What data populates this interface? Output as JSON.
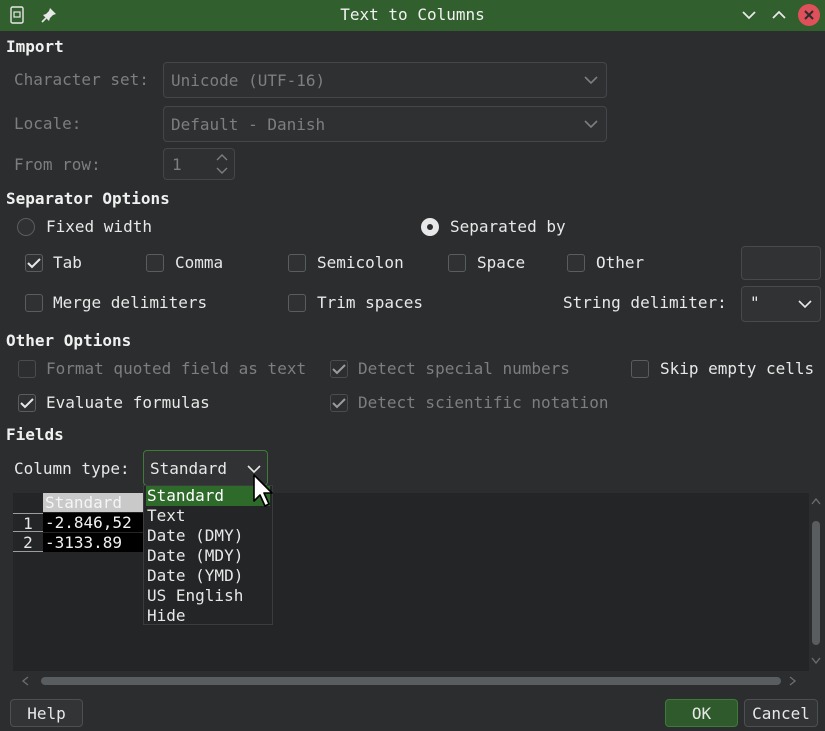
{
  "window": {
    "title": "Text to Columns"
  },
  "import": {
    "heading": "Import",
    "charset_label": "Character set:",
    "charset_value": "Unicode (UTF-16)",
    "locale_label": "Locale:",
    "locale_value": "Default - Danish",
    "fromrow_label": "From row:",
    "fromrow_value": "1"
  },
  "separator": {
    "heading": "Separator Options",
    "fixed_width": "Fixed width",
    "separated_by": "Separated by",
    "tab": "Tab",
    "comma": "Comma",
    "semicolon": "Semicolon",
    "space": "Space",
    "other": "Other",
    "merge": "Merge delimiters",
    "trim": "Trim spaces",
    "string_delim_label": "String delimiter:",
    "string_delim_value": "\"",
    "checked": {
      "tab": true,
      "comma": false,
      "semicolon": false,
      "space": false,
      "other": false,
      "merge": false,
      "trim": false
    },
    "mode": "separated"
  },
  "other_options": {
    "heading": "Other Options",
    "format_quoted": "Format quoted field as text",
    "detect_special": "Detect special numbers",
    "skip_empty": "Skip empty cells",
    "evaluate": "Evaluate formulas",
    "detect_sci": "Detect scientific notation"
  },
  "fields": {
    "heading": "Fields",
    "column_type_label": "Column type:",
    "column_type_value": "Standard",
    "preview_header": "Standard",
    "rows": [
      {
        "num": "1",
        "value": "-2.846,52"
      },
      {
        "num": "2",
        "value": "-3133.89"
      }
    ],
    "options": [
      "Standard",
      "Text",
      "Date (DMY)",
      "Date (MDY)",
      "Date (YMD)",
      "US English",
      "Hide"
    ]
  },
  "buttons": {
    "help": "Help",
    "ok": "OK",
    "cancel": "Cancel"
  },
  "colors": {
    "titlebar": "#315f2e",
    "accent": "#2e6a2a",
    "close": "#e0505a"
  }
}
